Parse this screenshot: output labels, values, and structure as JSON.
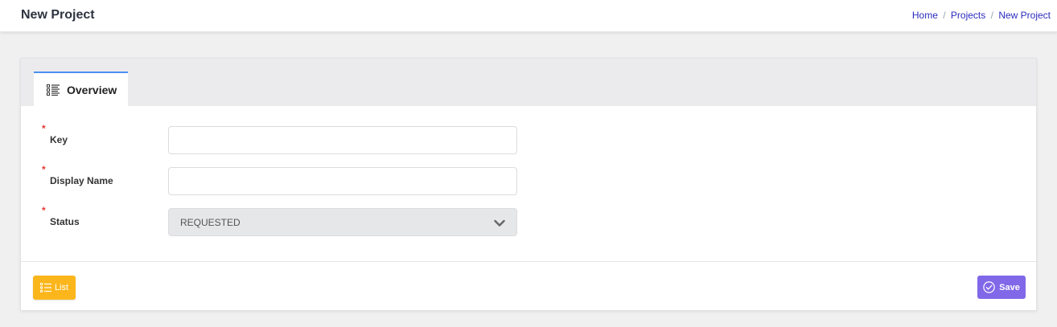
{
  "header": {
    "title": "New Project",
    "breadcrumb": {
      "home": "Home",
      "sep1": "/",
      "projects": "Projects",
      "sep2": "/",
      "current": "New Project"
    }
  },
  "tabs": [
    {
      "label": "Overview",
      "icon": "list-details-icon",
      "active": true
    }
  ],
  "form": {
    "required_marker": "*",
    "key": {
      "label": "Key",
      "value": "",
      "placeholder": ""
    },
    "display_name": {
      "label": "Display Name",
      "value": "",
      "placeholder": ""
    },
    "status": {
      "label": "Status",
      "selected": "REQUESTED"
    }
  },
  "actions": {
    "list_label": "List",
    "save_label": "Save"
  },
  "colors": {
    "accent_tab": "#4a8ff0",
    "list_button": "#fbb61c",
    "save_button": "#8068e8",
    "required": "#e53935",
    "breadcrumb_link": "#2b2bbf"
  }
}
